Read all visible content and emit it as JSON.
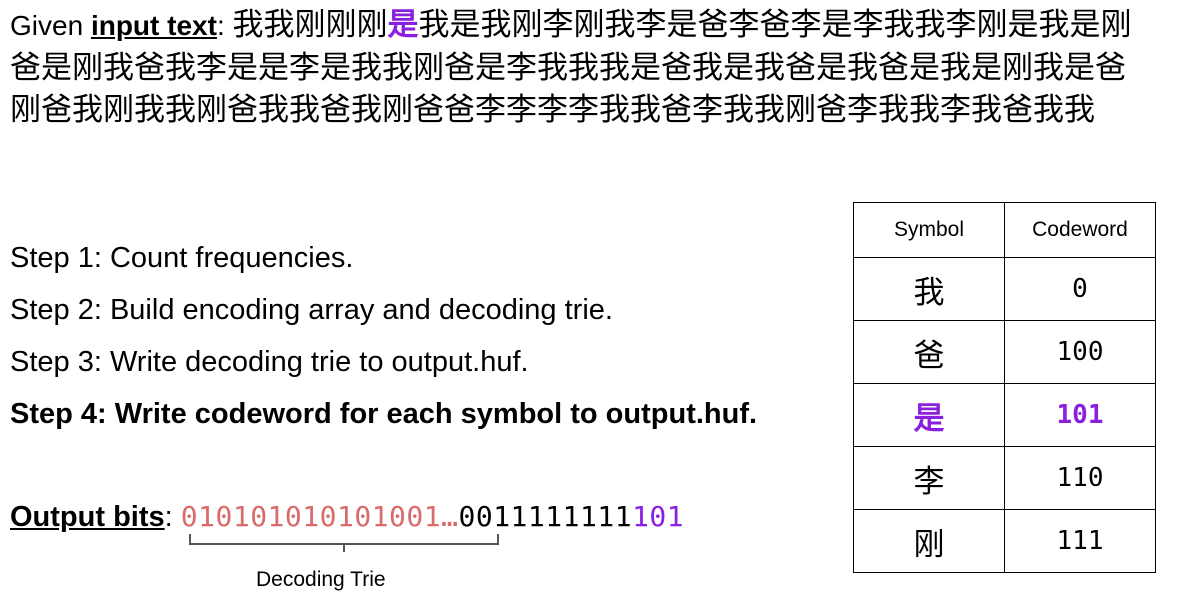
{
  "given": {
    "prefix": "Given ",
    "label": "input text",
    "colon": ": ",
    "before_highlight": "我我刚刚刚",
    "highlight": "是",
    "after_highlight": "我是我刚李刚我李是爸李爸李是李我我李刚是我是刚爸是刚我爸我李是是李是我我刚爸是李我我我是爸我是我爸是我爸是我是刚我是爸刚爸我刚我我刚爸我我爸我刚爸爸李李李李我我爸李我我刚爸李我我李我爸我我"
  },
  "steps": [
    "Step 1: Count frequencies.",
    "Step 2: Build encoding array and decoding trie.",
    "Step 3: Write decoding trie to output.huf.",
    "Step 4: Write codeword for each symbol to output.huf."
  ],
  "output": {
    "label": "Output bits",
    "colon": ": ",
    "trie_bits": "010101010101001…",
    "middle_bits": "0011111111",
    "last_bits": "101",
    "brace_label": "Decoding Trie"
  },
  "table": {
    "headers": [
      "Symbol",
      "Codeword"
    ],
    "rows": [
      {
        "symbol": "我",
        "codeword": "0"
      },
      {
        "symbol": "爸",
        "codeword": "100"
      },
      {
        "symbol": "是",
        "codeword": "101"
      },
      {
        "symbol": "李",
        "codeword": "110"
      },
      {
        "symbol": "刚",
        "codeword": "111"
      }
    ],
    "highlighted_row": 2
  },
  "colors": {
    "highlight": "#8a1fe0",
    "trie_bits": "#d96b6b"
  }
}
